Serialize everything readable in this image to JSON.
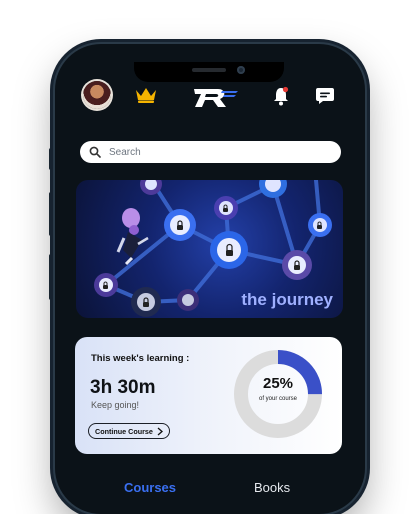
{
  "header": {
    "avatar_icon": "user-avatar",
    "premium_icon": "crown-icon",
    "logo_icon": "app-logo",
    "notification_icon": "bell-icon",
    "message_icon": "chat-bubble-icon"
  },
  "search": {
    "placeholder": "Search",
    "icon": "search-icon"
  },
  "banner": {
    "title": "the journey"
  },
  "learning": {
    "label": "This week's learning :",
    "time": "3h 30m",
    "subtitle": "Keep going!",
    "button_label": "Continue Course",
    "progress_percent": 25,
    "progress_text": "25%",
    "progress_caption": "of your course"
  },
  "tabs": [
    {
      "label": "Courses",
      "active": true
    },
    {
      "label": "Books",
      "active": false
    }
  ],
  "colors": {
    "accent": "#3a6ff0",
    "screen_bg": "#0b1218",
    "progress_fill": "#3a50c8",
    "progress_track": "#dcdcdc"
  }
}
